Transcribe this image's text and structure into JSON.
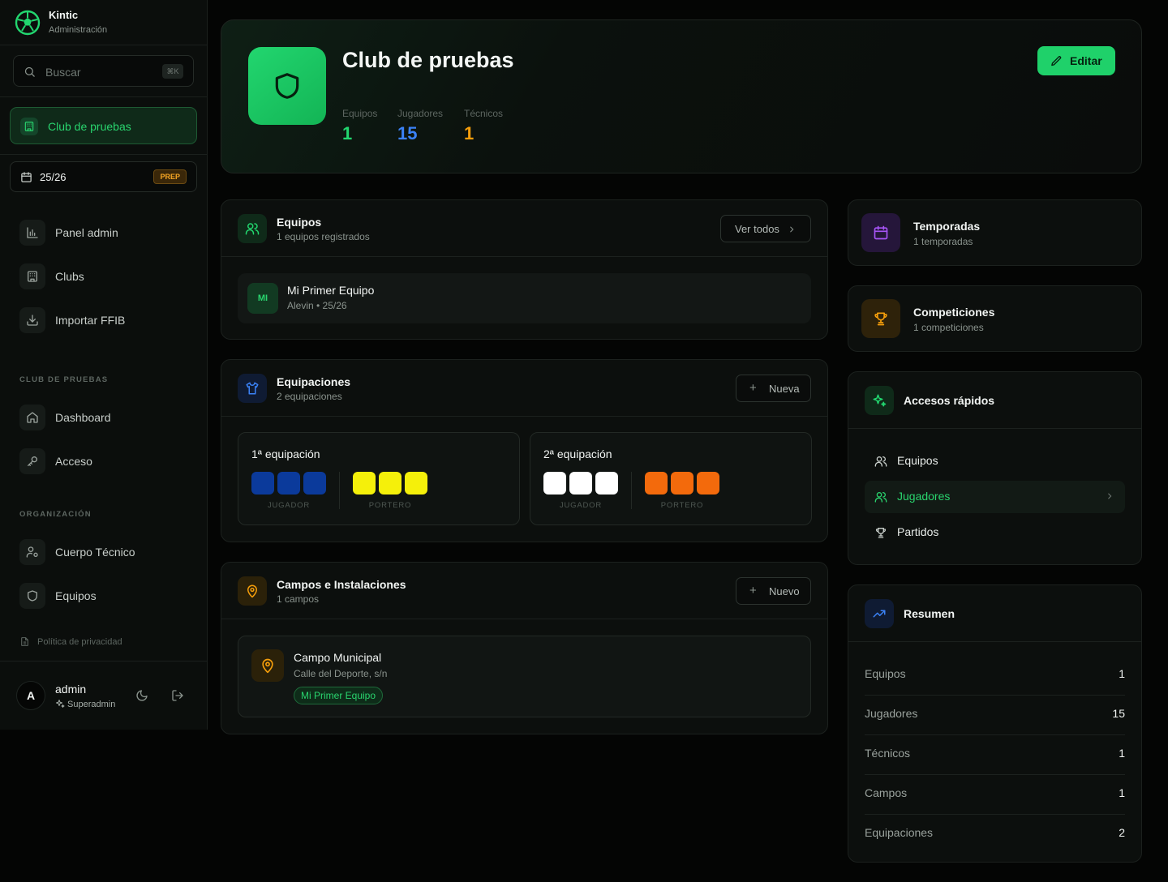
{
  "brand": {
    "name": "Kintic",
    "subtitle": "Administración"
  },
  "search": {
    "placeholder": "Buscar",
    "shortcut": "⌘K"
  },
  "current_club": {
    "label": "Club de pruebas"
  },
  "season": {
    "label": "25/26",
    "badge": "PREP"
  },
  "nav_main": [
    {
      "label": "Panel admin",
      "icon": "bar-chart-icon"
    },
    {
      "label": "Clubs",
      "icon": "building-icon"
    },
    {
      "label": "Importar FFIB",
      "icon": "download-icon"
    }
  ],
  "section_club": {
    "title": "CLUB DE PRUEBAS",
    "items": [
      {
        "label": "Dashboard",
        "icon": "home-icon"
      },
      {
        "label": "Acceso",
        "icon": "key-icon"
      }
    ]
  },
  "section_org": {
    "title": "ORGANIZACIÓN",
    "items": [
      {
        "label": "Cuerpo Técnico",
        "icon": "user-cog-icon"
      },
      {
        "label": "Equipos",
        "icon": "shield-icon"
      }
    ]
  },
  "privacy": {
    "label": "Política de privacidad"
  },
  "user": {
    "initial": "A",
    "name": "admin",
    "role": "Superadmin"
  },
  "hero": {
    "title": "Club de pruebas",
    "edit_label": "Editar",
    "stats": [
      {
        "label": "Equipos",
        "value": "1",
        "color": "#22d66f"
      },
      {
        "label": "Jugadores",
        "value": "15",
        "color": "#3b82f6"
      },
      {
        "label": "Técnicos",
        "value": "1",
        "color": "#f59e0b"
      }
    ]
  },
  "teams_card": {
    "title": "Equipos",
    "subtitle": "1 equipos registrados",
    "button": "Ver todos",
    "items": [
      {
        "initials": "MI",
        "name": "Mi Primer Equipo",
        "meta": "Alevin • 25/26"
      }
    ]
  },
  "kits_card": {
    "title": "Equipaciones",
    "subtitle": "2 equipaciones",
    "button": "Nueva",
    "kits": [
      {
        "title": "1ª equipación",
        "player_label": "JUGADOR",
        "keeper_label": "PORTERO",
        "player_colors": [
          "#0b3a9b",
          "#0b3a9b",
          "#0b3a9b"
        ],
        "keeper_colors": [
          "#f5f00a",
          "#f5f00a",
          "#f5f00a"
        ]
      },
      {
        "title": "2ª equipación",
        "player_label": "JUGADOR",
        "keeper_label": "PORTERO",
        "player_colors": [
          "#ffffff",
          "#ffffff",
          "#ffffff"
        ],
        "keeper_colors": [
          "#f36a0c",
          "#f36a0c",
          "#f36a0c"
        ]
      }
    ]
  },
  "fields_card": {
    "title": "Campos e Instalaciones",
    "subtitle": "1 campos",
    "button": "Nuevo",
    "items": [
      {
        "name": "Campo Municipal",
        "address": "Calle del Deporte, s/n",
        "tag": "Mi Primer Equipo"
      }
    ]
  },
  "seasons_card": {
    "title": "Temporadas",
    "subtitle": "1 temporadas"
  },
  "competitions_card": {
    "title": "Competiciones",
    "subtitle": "1 competiciones"
  },
  "quick_access": {
    "title": "Accesos rápidos",
    "items": [
      {
        "label": "Equipos",
        "active": false
      },
      {
        "label": "Jugadores",
        "active": true
      },
      {
        "label": "Partidos",
        "active": false
      }
    ]
  },
  "summary": {
    "title": "Resumen",
    "rows": [
      {
        "label": "Equipos",
        "value": "1"
      },
      {
        "label": "Jugadores",
        "value": "15"
      },
      {
        "label": "Técnicos",
        "value": "1"
      },
      {
        "label": "Campos",
        "value": "1"
      },
      {
        "label": "Equipaciones",
        "value": "2"
      }
    ]
  }
}
